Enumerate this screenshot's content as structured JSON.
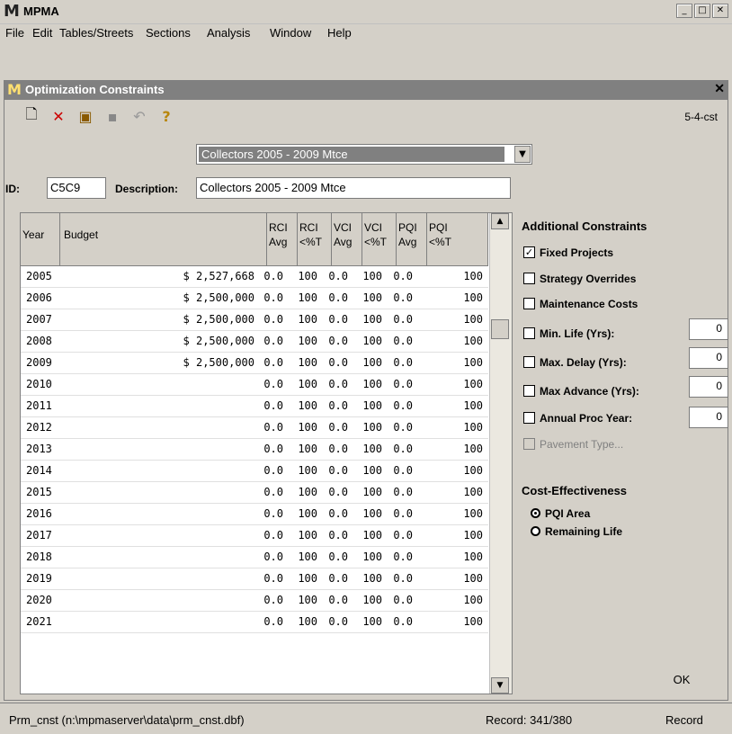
{
  "app": {
    "title": "MPMA"
  },
  "menu": [
    "File",
    "Edit",
    "Tables/Streets",
    "Sections",
    "Analysis",
    "Window",
    "Help"
  ],
  "window": {
    "title": "Optimization Constraints",
    "record_id": "5-4-cst"
  },
  "scenario_select": {
    "selected": "Collectors 2005 - 2009 Mtce"
  },
  "form": {
    "id_label": "ID:",
    "id_value": "C5C9",
    "description_label": "Description:",
    "description_value": "Collectors 2005 - 2009 Mtce"
  },
  "grid": {
    "headers": {
      "year": "Year",
      "budget": "Budget",
      "rci_avg": [
        "RCI",
        "Avg"
      ],
      "rci_pct": [
        "RCI",
        "<%T"
      ],
      "vci_avg": [
        "VCI",
        "Avg"
      ],
      "vci_pct": [
        "VCI",
        "<%T"
      ],
      "pqi_avg": [
        "PQI",
        "Avg"
      ],
      "pqi_pct": [
        "PQI",
        "<%T"
      ]
    },
    "rows": [
      {
        "year": "2005",
        "budget": "$ 2,527,668",
        "rci_avg": "0.0",
        "rci_pct": "100",
        "vci_avg": "0.0",
        "vci_pct": "100",
        "pqi_avg": "0.0",
        "pqi_pct": "100"
      },
      {
        "year": "2006",
        "budget": "$ 2,500,000",
        "rci_avg": "0.0",
        "rci_pct": "100",
        "vci_avg": "0.0",
        "vci_pct": "100",
        "pqi_avg": "0.0",
        "pqi_pct": "100"
      },
      {
        "year": "2007",
        "budget": "$ 2,500,000",
        "rci_avg": "0.0",
        "rci_pct": "100",
        "vci_avg": "0.0",
        "vci_pct": "100",
        "pqi_avg": "0.0",
        "pqi_pct": "100"
      },
      {
        "year": "2008",
        "budget": "$ 2,500,000",
        "rci_avg": "0.0",
        "rci_pct": "100",
        "vci_avg": "0.0",
        "vci_pct": "100",
        "pqi_avg": "0.0",
        "pqi_pct": "100"
      },
      {
        "year": "2009",
        "budget": "$ 2,500,000",
        "rci_avg": "0.0",
        "rci_pct": "100",
        "vci_avg": "0.0",
        "vci_pct": "100",
        "pqi_avg": "0.0",
        "pqi_pct": "100"
      },
      {
        "year": "2010",
        "budget": "",
        "rci_avg": "0.0",
        "rci_pct": "100",
        "vci_avg": "0.0",
        "vci_pct": "100",
        "pqi_avg": "0.0",
        "pqi_pct": "100"
      },
      {
        "year": "2011",
        "budget": "",
        "rci_avg": "0.0",
        "rci_pct": "100",
        "vci_avg": "0.0",
        "vci_pct": "100",
        "pqi_avg": "0.0",
        "pqi_pct": "100"
      },
      {
        "year": "2012",
        "budget": "",
        "rci_avg": "0.0",
        "rci_pct": "100",
        "vci_avg": "0.0",
        "vci_pct": "100",
        "pqi_avg": "0.0",
        "pqi_pct": "100"
      },
      {
        "year": "2013",
        "budget": "",
        "rci_avg": "0.0",
        "rci_pct": "100",
        "vci_avg": "0.0",
        "vci_pct": "100",
        "pqi_avg": "0.0",
        "pqi_pct": "100"
      },
      {
        "year": "2014",
        "budget": "",
        "rci_avg": "0.0",
        "rci_pct": "100",
        "vci_avg": "0.0",
        "vci_pct": "100",
        "pqi_avg": "0.0",
        "pqi_pct": "100"
      },
      {
        "year": "2015",
        "budget": "",
        "rci_avg": "0.0",
        "rci_pct": "100",
        "vci_avg": "0.0",
        "vci_pct": "100",
        "pqi_avg": "0.0",
        "pqi_pct": "100"
      },
      {
        "year": "2016",
        "budget": "",
        "rci_avg": "0.0",
        "rci_pct": "100",
        "vci_avg": "0.0",
        "vci_pct": "100",
        "pqi_avg": "0.0",
        "pqi_pct": "100"
      },
      {
        "year": "2017",
        "budget": "",
        "rci_avg": "0.0",
        "rci_pct": "100",
        "vci_avg": "0.0",
        "vci_pct": "100",
        "pqi_avg": "0.0",
        "pqi_pct": "100"
      },
      {
        "year": "2018",
        "budget": "",
        "rci_avg": "0.0",
        "rci_pct": "100",
        "vci_avg": "0.0",
        "vci_pct": "100",
        "pqi_avg": "0.0",
        "pqi_pct": "100"
      },
      {
        "year": "2019",
        "budget": "",
        "rci_avg": "0.0",
        "rci_pct": "100",
        "vci_avg": "0.0",
        "vci_pct": "100",
        "pqi_avg": "0.0",
        "pqi_pct": "100"
      },
      {
        "year": "2020",
        "budget": "",
        "rci_avg": "0.0",
        "rci_pct": "100",
        "vci_avg": "0.0",
        "vci_pct": "100",
        "pqi_avg": "0.0",
        "pqi_pct": "100"
      },
      {
        "year": "2021",
        "budget": "",
        "rci_avg": "0.0",
        "rci_pct": "100",
        "vci_avg": "0.0",
        "vci_pct": "100",
        "pqi_avg": "0.0",
        "pqi_pct": "100"
      }
    ]
  },
  "constraints": {
    "heading": "Additional Constraints",
    "fixed_projects": {
      "label": "Fixed Projects",
      "checked": true
    },
    "strategy_overrides": {
      "label": "Strategy Overrides",
      "checked": false
    },
    "maintenance_costs": {
      "label": "Maintenance Costs",
      "checked": false
    },
    "min_life": {
      "label": "Min. Life (Yrs):",
      "checked": false,
      "value": "0"
    },
    "max_delay": {
      "label": "Max. Delay (Yrs):",
      "checked": false,
      "value": "0"
    },
    "max_advance": {
      "label": "Max Advance (Yrs):",
      "checked": false,
      "value": "0"
    },
    "annual_proc_year": {
      "label": "Annual Proc Year:",
      "checked": false,
      "value": "0"
    },
    "pavement_type": {
      "label": "Pavement Type...",
      "checked": false,
      "disabled": true
    }
  },
  "cost_effectiveness": {
    "heading": "Cost-Effectiveness",
    "options": [
      {
        "label": "PQI Area",
        "selected": true
      },
      {
        "label": "Remaining Life",
        "selected": false
      }
    ]
  },
  "buttons": {
    "ok": "OK"
  },
  "status": {
    "file": "Prm_cnst (n:\\mpmaserver\\data\\prm_cnst.dbf)",
    "record": "Record: 341/380",
    "mode": "Record"
  },
  "icons": [
    "new-icon",
    "delete-icon",
    "copy-icon",
    "save-icon",
    "undo-icon",
    "help-icon"
  ],
  "colors": {
    "selection": "#808080",
    "title_active": "#808080",
    "logo_yellow": "#ffe070"
  }
}
